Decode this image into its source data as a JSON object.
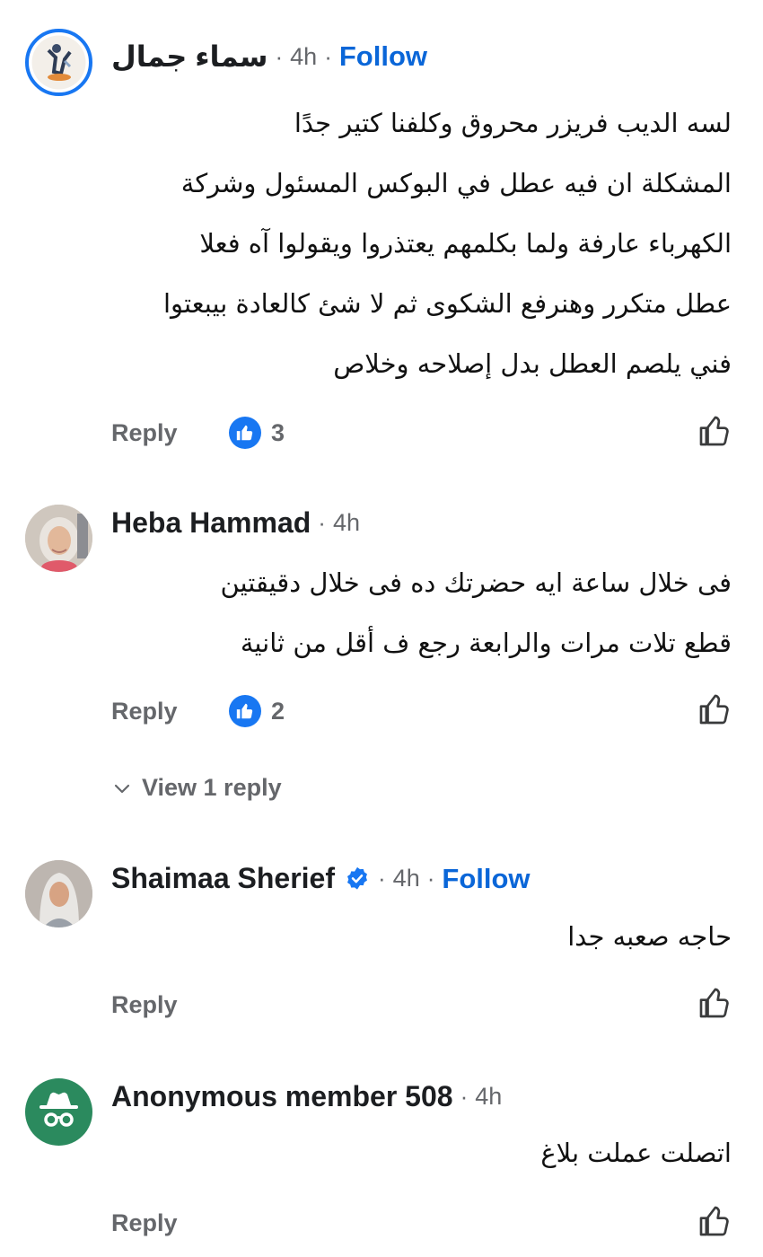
{
  "comments": [
    {
      "author": "سماء جمال",
      "time": "4h",
      "follow": "Follow",
      "lines": [
        "لسه الديب فريزر محروق وكلفنا كتير جدًا",
        "المشكلة ان فيه عطل في البوكس المسئول وشركة",
        "الكهرباء عارفة ولما بكلمهم يعتذروا ويقولوا آه فعلا",
        "عطل متكرر وهنرفع الشكوى ثم لا شئ كالعادة بيبعتوا",
        "فني يلصم العطل بدل إصلاحه وخلاص"
      ],
      "reply": "Reply",
      "reactions": "3"
    },
    {
      "author": "Heba Hammad",
      "time": "4h",
      "lines": [
        "فى خلال ساعة ايه حضرتك ده فى خلال دقيقتين",
        "قطع تلات مرات  والرابعة رجع ف أقل من ثانية"
      ],
      "reply": "Reply",
      "reactions": "2",
      "view_replies": "View 1 reply"
    },
    {
      "author": "Shaimaa Sherief",
      "time": "4h",
      "follow": "Follow",
      "lines": [
        "حاجه صعبه جدا"
      ],
      "reply": "Reply"
    },
    {
      "author": "Anonymous member 508",
      "time": "4h",
      "lines": [
        "اتصلت عملت بلاغ"
      ],
      "reply": "Reply"
    }
  ],
  "icons": {
    "like_badge": "thumbs-up-filled-icon",
    "like_button": "thumbs-up-outline-icon",
    "verified": "verified-badge-icon",
    "anonymous": "incognito-icon",
    "chevron": "chevron-down-icon"
  },
  "colors": {
    "link_blue": "#0a66d8",
    "like_blue": "#1877f2",
    "secondary_text": "#65676b",
    "anonymous_green": "#2b8a5e"
  }
}
